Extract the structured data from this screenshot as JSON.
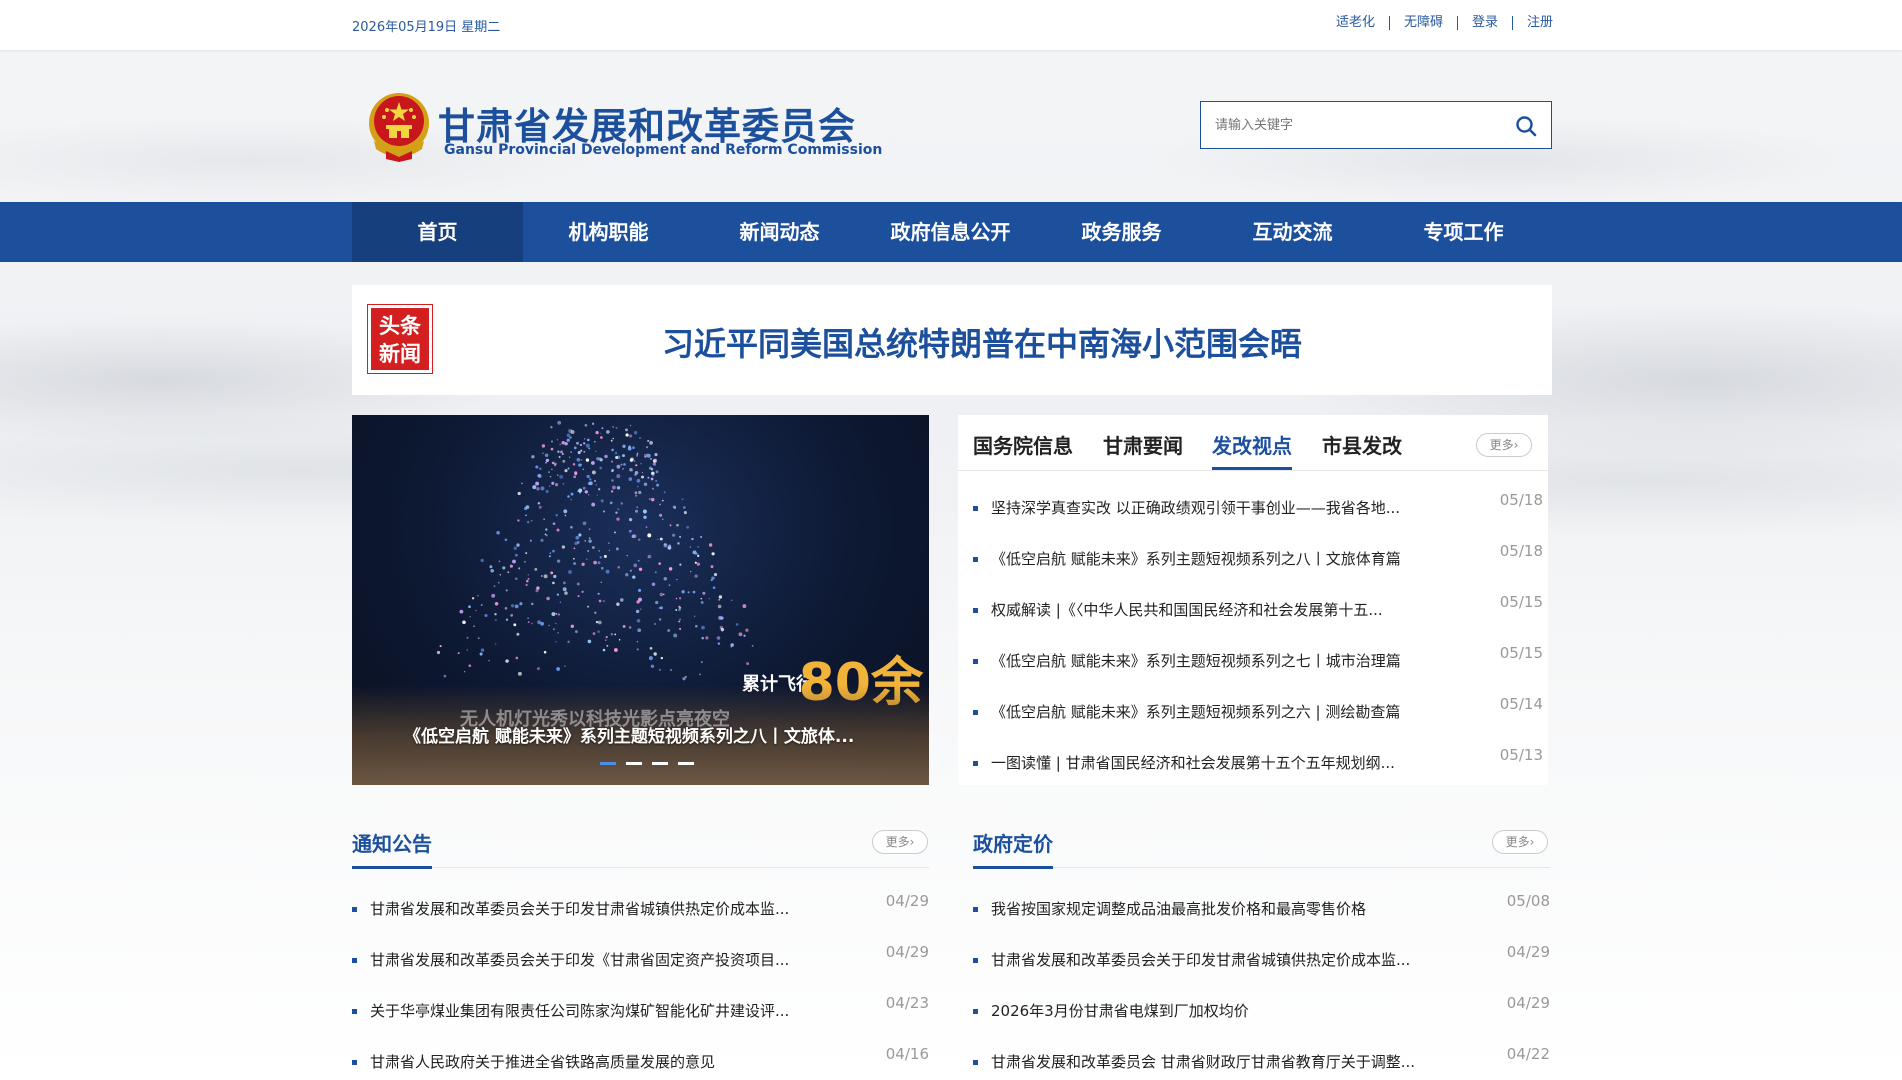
{
  "topbar": {
    "date": "2026年05月19日 星期二",
    "links": [
      "适老化",
      "无障碍",
      "登录",
      "注册"
    ]
  },
  "header": {
    "title": "甘肃省发展和改革委员会",
    "subtitle": "Gansu Provincial Development and Reform Commission",
    "search_placeholder": "请输入关键字"
  },
  "nav": {
    "items": [
      "首页",
      "机构职能",
      "新闻动态",
      "政府信息公开",
      "政务服务",
      "互动交流",
      "专项工作"
    ],
    "active_index": 0
  },
  "headline": {
    "badge_line1": "头条",
    "badge_line2": "新闻",
    "title": "习近平同美国总统特朗普在中南海小范围会晤"
  },
  "carousel": {
    "caption": "《低空启航 赋能未来》系列主题短视频系列之八丨文旅体...",
    "overlay_text_small": "累计飞行",
    "overlay_text_big": "80余",
    "overlay_ghost": "无人机灯光秀以科技光影点亮夜空",
    "slide_count": 4,
    "active_slide": 0
  },
  "tabs_panel": {
    "tabs": [
      "国务院信息",
      "甘肃要闻",
      "发改视点",
      "市县发改"
    ],
    "active_index": 2,
    "more_label": "更多›",
    "items": [
      {
        "title": "坚持深学真查实改 以正确政绩观引领干事创业——我省各地...",
        "date": "05/18"
      },
      {
        "title": "《低空启航 赋能未来》系列主题短视频系列之八丨文旅体育篇",
        "date": "05/18"
      },
      {
        "title": "权威解读 |《〈中华人民共和国国民经济和社会发展第十五...",
        "date": "05/15"
      },
      {
        "title": "《低空启航 赋能未来》系列主题短视频系列之七丨城市治理篇",
        "date": "05/15"
      },
      {
        "title": "《低空启航 赋能未来》系列主题短视频系列之六 | 测绘勘查篇",
        "date": "05/14"
      },
      {
        "title": "一图读懂 | 甘肃省国民经济和社会发展第十五个五年规划纲...",
        "date": "05/13"
      }
    ]
  },
  "notices": {
    "title": "通知公告",
    "more_label": "更多›",
    "items": [
      {
        "title": "甘肃省发展和改革委员会关于印发甘肃省城镇供热定价成本监...",
        "date": "04/29"
      },
      {
        "title": "甘肃省发展和改革委员会关于印发《甘肃省固定资产投资项目...",
        "date": "04/29"
      },
      {
        "title": "关于华亭煤业集团有限责任公司陈家沟煤矿智能化矿井建设评...",
        "date": "04/23"
      },
      {
        "title": "甘肃省人民政府关于推进全省铁路高质量发展的意见",
        "date": "04/16"
      }
    ]
  },
  "pricing": {
    "title": "政府定价",
    "more_label": "更多›",
    "items": [
      {
        "title": "我省按国家规定调整成品油最高批发价格和最高零售价格",
        "date": "05/08"
      },
      {
        "title": "甘肃省发展和改革委员会关于印发甘肃省城镇供热定价成本监...",
        "date": "04/29"
      },
      {
        "title": "2026年3月份甘肃省电煤到厂加权均价",
        "date": "04/29"
      },
      {
        "title": "甘肃省发展和改革委员会 甘肃省财政厅甘肃省教育厅关于调整...",
        "date": "04/22"
      }
    ]
  },
  "colors": {
    "brand_blue": "#1c4f9c",
    "nav_active": "#163f7d",
    "headline_badge_red": "#d31f1f",
    "carousel_number": "#f2b33a"
  }
}
